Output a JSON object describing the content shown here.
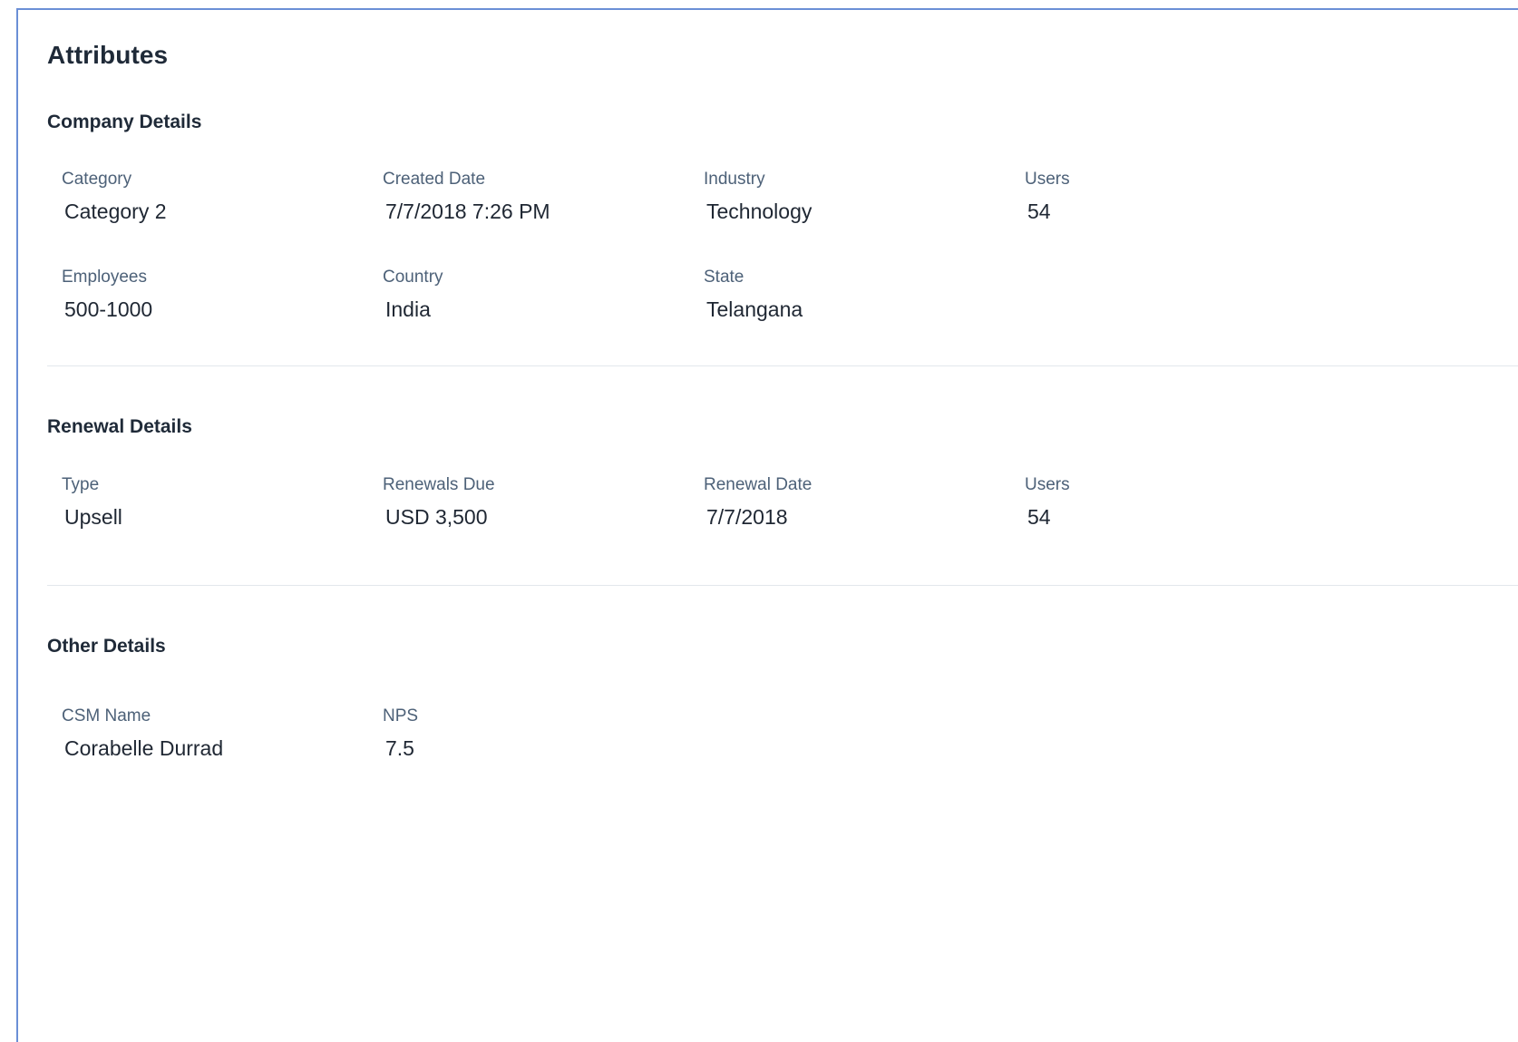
{
  "page": {
    "title": "Attributes"
  },
  "sections": [
    {
      "title": "Company Details",
      "fields": [
        {
          "label": "Category",
          "value": "Category 2"
        },
        {
          "label": "Created Date",
          "value": "7/7/2018  7:26 PM"
        },
        {
          "label": "Industry",
          "value": "Technology"
        },
        {
          "label": "Users",
          "value": "54"
        },
        {
          "label": "Employees",
          "value": "500-1000"
        },
        {
          "label": "Country",
          "value": "India"
        },
        {
          "label": "State",
          "value": "Telangana"
        }
      ]
    },
    {
      "title": "Renewal Details",
      "fields": [
        {
          "label": "Type",
          "value": "Upsell"
        },
        {
          "label": "Renewals Due",
          "value": "USD 3,500"
        },
        {
          "label": "Renewal Date",
          "value": "7/7/2018"
        },
        {
          "label": "Users",
          "value": "54"
        }
      ]
    },
    {
      "title": "Other Details",
      "fields": [
        {
          "label": "CSM Name",
          "value": "Corabelle Durrad"
        },
        {
          "label": "NPS",
          "value": "7.5"
        }
      ]
    }
  ],
  "colors": {
    "panel_border": "#6b8fd6",
    "label": "#4d6178",
    "value": "#1f2733",
    "divider": "#e3e7ec"
  }
}
